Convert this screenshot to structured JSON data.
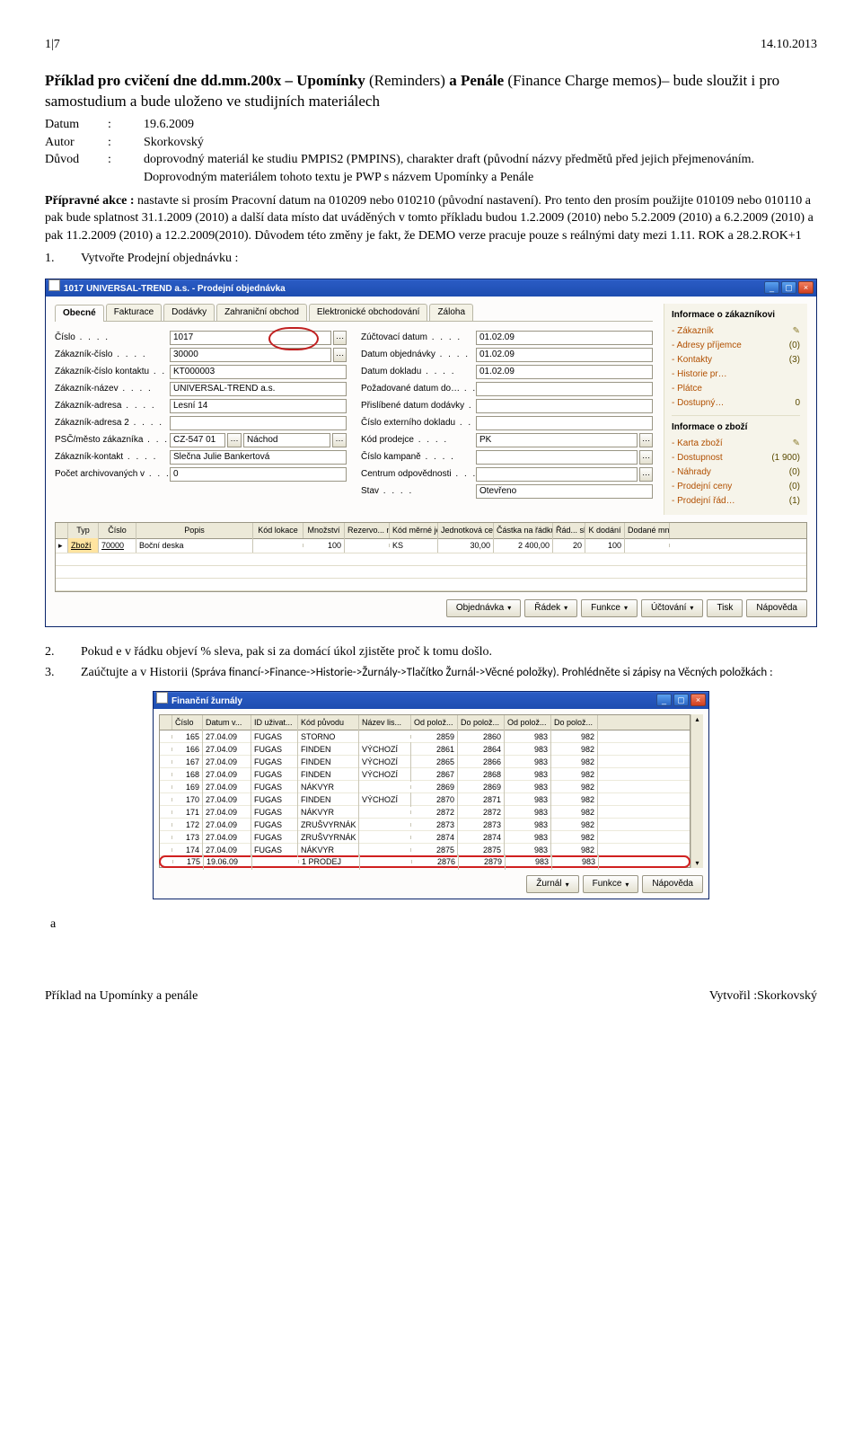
{
  "page_header": {
    "left": "1|7",
    "right": "14.10.2013"
  },
  "title": {
    "prefix": "Příklad pro cvičení dne dd.mm.200x – Upomínky ",
    "rem": "(Reminders)",
    "mid": " a Penále ",
    "fin": "(Finance Charge memos)",
    "suffix": "– bude sloužit i pro samostudium a bude uloženo ve studijních materiálech"
  },
  "meta": {
    "datum_l": "Datum",
    "datum_v": "19.6.2009",
    "autor_l": "Autor",
    "autor_v": "Skorkovský",
    "duvod_l": "Důvod",
    "duvod_v1": "doprovodný materiál ke studiu PMPIS2 (PMPINS), charakter draft (původní názvy předmětů před jejich přejmenováním. Doprovodným materiálem tohoto textu je PWP s názvem Upomínky a Penále"
  },
  "prep": {
    "lead_b": "Přípravné akce :",
    "text": " nastavte si prosím  Pracovní datum na 010209 nebo 010210 (původní nastavení). Pro tento den prosím použijte 010109 nebo 010110 a pak bude splatnost 31.1.2009 (2010) a další data místo dat uváděných v tomto příkladu budou 1.2.2009 (2010) nebo 5.2.2009 (2010) a 6.2.2009 (2010) a pak 11.2.2009 (2010) a 12.2.2009(2010). Důvodem této změny je fakt, že DEMO verze pracuje pouze s reálnými daty mezi 1.11. ROK a 28.2.ROK+1"
  },
  "step1_num": "1.",
  "step1_txt": "Vytvořte Prodejní objednávku   :",
  "win1": {
    "title": "1017 UNIVERSAL-TREND a.s. - Prodejní objednávka",
    "tabs": [
      "Obecné",
      "Fakturace",
      "Dodávky",
      "Zahraniční obchod",
      "Elektronické obchodování",
      "Záloha"
    ],
    "leftcol": [
      {
        "l": "Číslo",
        "v": "1017",
        "b": 1
      },
      {
        "l": "Zákazník-číslo",
        "v": "30000",
        "b": 1
      },
      {
        "l": "Zákazník-číslo kontaktu",
        "v": "KT000003"
      },
      {
        "l": "Zákazník-název",
        "v": "UNIVERSAL-TREND a.s."
      },
      {
        "l": "Zákazník-adresa",
        "v": "Lesní 14"
      },
      {
        "l": "Zákazník-adresa 2",
        "v": ""
      },
      {
        "l": "PSČ/město zákazníka",
        "v": "CZ-547 01",
        "v2": "Náchod",
        "b": 1,
        "b2": 1
      },
      {
        "l": "Zákazník-kontakt",
        "v": "Slečna Julie Bankertová"
      },
      {
        "l": "Počet archivovaných v",
        "v": "0"
      }
    ],
    "rightcol": [
      {
        "l": "Zúčtovací datum",
        "v": "01.02.09"
      },
      {
        "l": "Datum objednávky",
        "v": "01.02.09"
      },
      {
        "l": "Datum dokladu",
        "v": "01.02.09"
      },
      {
        "l": "Požadované datum do…",
        "v": ""
      },
      {
        "l": "Přislíbené datum dodávky",
        "v": ""
      },
      {
        "l": "Číslo externího dokladu",
        "v": ""
      },
      {
        "l": "Kód prodejce",
        "v": "PK",
        "b": 1
      },
      {
        "l": "Číslo kampaně",
        "v": "",
        "b": 1
      },
      {
        "l": "Centrum odpovědnosti",
        "v": "",
        "b": 1
      },
      {
        "l": "Stav",
        "v": "Otevřeno"
      }
    ],
    "side": {
      "title1": "Informace o zákazníkovi",
      "rows1": [
        {
          "k": "Zákazník",
          "pencil": "✎"
        },
        {
          "k": "Adresy příjemce",
          "v": "(0)"
        },
        {
          "k": "Kontakty",
          "v": "(3)"
        },
        {
          "k": "Historie pr…"
        },
        {
          "k": "Plátce"
        },
        {
          "k": "Dostupný…",
          "v": "0"
        }
      ],
      "title2": "Informace o zboží",
      "rows2": [
        {
          "k": "Karta zboží",
          "pencil": "✎"
        },
        {
          "k": "Dostupnost",
          "v": "(1 900)"
        },
        {
          "k": "Náhrady",
          "v": "(0)"
        },
        {
          "k": "Prodejní ceny",
          "v": "(0)"
        },
        {
          "k": "Prodejní řád…",
          "v": "(1)"
        }
      ]
    },
    "grid": {
      "head": [
        "",
        "Typ",
        "Číslo",
        "Popis",
        "Kód lokace",
        "Množství",
        "Rezervo... množství",
        "Kód měrné jednotky",
        "Jednotková cena bez DPH",
        "Částka na řádku bez DPH",
        "Řád... sleva %",
        "K dodání",
        "Dodané množství"
      ],
      "row": [
        "▸",
        "Zboží",
        "70000",
        "Boční deska",
        "",
        "100",
        "",
        "KS",
        "30,00",
        "2 400,00",
        "20",
        "100",
        ""
      ]
    },
    "buttons": [
      "Objednávka",
      "Řádek",
      "Funkce",
      "Účtování",
      "Tisk",
      "Nápověda"
    ]
  },
  "mid_list": [
    {
      "n": "2.",
      "t": "Pokud e v řádku objeví % sleva, pak si  za domácí úkol  zjistěte proč k tomu došlo."
    },
    {
      "n": "3.",
      "t1": "Zaúčtujte a v Historii ",
      "t2": "(Správa financí->Finance->Historie->Žurnály->Tlačítko Žurnál->Věcné položky)",
      "t3": ". Prohlédněte si zápisy na Věcných položkách :"
    }
  ],
  "win2": {
    "title": "Finanční žurnály",
    "head": [
      "Číslo",
      "Datum v...",
      "ID uživat...",
      "Kód původu",
      "Název lis...",
      "Od polož...",
      "Do polož...",
      "Od polož...",
      "Do polož..."
    ],
    "rows": [
      [
        "165",
        "27.04.09",
        "FUGAS",
        "STORNO",
        "",
        "2859",
        "2860",
        "983",
        "982"
      ],
      [
        "166",
        "27.04.09",
        "FUGAS",
        "FINDEN",
        "VÝCHOZÍ",
        "2861",
        "2864",
        "983",
        "982"
      ],
      [
        "167",
        "27.04.09",
        "FUGAS",
        "FINDEN",
        "VÝCHOZÍ",
        "2865",
        "2866",
        "983",
        "982"
      ],
      [
        "168",
        "27.04.09",
        "FUGAS",
        "FINDEN",
        "VÝCHOZÍ",
        "2867",
        "2868",
        "983",
        "982"
      ],
      [
        "169",
        "27.04.09",
        "FUGAS",
        "NÁKVYR",
        "",
        "2869",
        "2869",
        "983",
        "982"
      ],
      [
        "170",
        "27.04.09",
        "FUGAS",
        "FINDEN",
        "VÝCHOZÍ",
        "2870",
        "2871",
        "983",
        "982"
      ],
      [
        "171",
        "27.04.09",
        "FUGAS",
        "NÁKVYR",
        "",
        "2872",
        "2872",
        "983",
        "982"
      ],
      [
        "172",
        "27.04.09",
        "FUGAS",
        "ZRUŠVYRNÁK",
        "",
        "2873",
        "2873",
        "983",
        "982"
      ],
      [
        "173",
        "27.04.09",
        "FUGAS",
        "ZRUŠVYRNÁK",
        "",
        "2874",
        "2874",
        "983",
        "982"
      ],
      [
        "174",
        "27.04.09",
        "FUGAS",
        "NÁKVYR",
        "",
        "2875",
        "2875",
        "983",
        "982"
      ],
      [
        "175",
        "19.06.09",
        "",
        "1 PRODEJ",
        "",
        "2876",
        "2879",
        "983",
        "983"
      ]
    ],
    "buttons": [
      "Žurnál",
      "Funkce",
      "Nápověda"
    ]
  },
  "letter_a": "a",
  "footer": {
    "left": "Příklad na Upomínky a penále",
    "right": "Vytvořil :Skorkovský"
  }
}
